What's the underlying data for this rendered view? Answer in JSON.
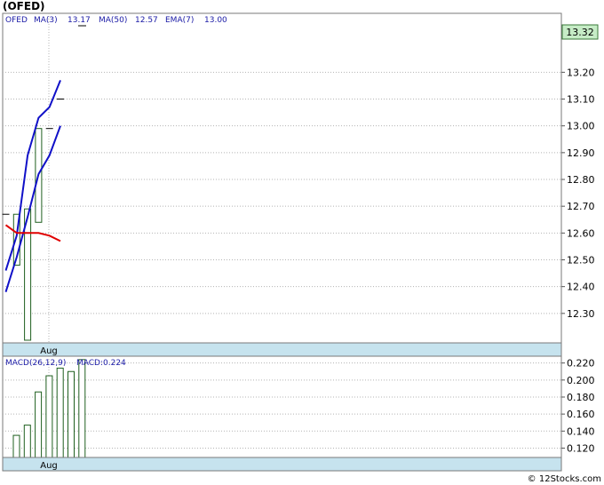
{
  "chart_data": [
    {
      "type": "candlestick",
      "title": "(OFED)",
      "legend": {
        "ticker": "OFED",
        "ma3_label": "MA(3)",
        "ma3_value": "13.17",
        "ma50_label": "MA(50)",
        "ma50_value": "12.57",
        "ema7_label": "EMA(7)",
        "ema7_value": "13.00"
      },
      "last_price": "13.32",
      "x_label": "Aug",
      "ylim": [
        12.19,
        13.42
      ],
      "yticks": [
        "12.30",
        "12.40",
        "12.50",
        "12.60",
        "12.70",
        "12.80",
        "12.90",
        "13.00",
        "13.10",
        "13.20"
      ],
      "grid": true,
      "candles": [
        {
          "open": 12.67,
          "high": 12.67,
          "low": 12.67,
          "close": 12.67
        },
        {
          "open": 12.48,
          "high": 12.67,
          "low": 12.48,
          "close": 12.67
        },
        {
          "open": 12.2,
          "high": 12.69,
          "low": 12.2,
          "close": 12.69
        },
        {
          "open": 12.64,
          "high": 12.99,
          "low": 12.64,
          "close": 12.99
        },
        {
          "open": 12.99,
          "high": 12.99,
          "low": 12.99,
          "close": 12.99
        },
        {
          "open": 13.1,
          "high": 13.1,
          "low": 13.1,
          "close": 13.1
        }
      ],
      "series": [
        {
          "name": "MA(3)",
          "color": "#1010c8",
          "values": [
            12.46,
            12.59,
            12.89,
            13.03,
            13.07,
            13.17
          ]
        },
        {
          "name": "EMA(7)",
          "color": "#1010c8",
          "values": [
            12.38,
            12.51,
            12.66,
            12.82,
            12.89,
            13.0
          ]
        },
        {
          "name": "MA(50)",
          "color": "#e00000",
          "values": [
            12.63,
            12.6,
            12.6,
            12.6,
            12.59,
            12.57
          ]
        }
      ]
    },
    {
      "type": "bar",
      "title": "MACD(26,12,9)",
      "value_label": "MACD:0.224",
      "x_label": "Aug",
      "ylim": [
        0.109,
        0.228
      ],
      "yticks": [
        "0.120",
        "0.140",
        "0.160",
        "0.180",
        "0.200",
        "0.220"
      ],
      "grid": true,
      "values": [
        0.135,
        0.147,
        0.186,
        0.205,
        0.214,
        0.21,
        0.224
      ]
    }
  ],
  "watermark": "© 12Stocks.com",
  "colors": {
    "bar_fill": "#ffffff",
    "bar_stroke": "#1f5f1f",
    "axis_band": "#c6e3ee",
    "grid": "#b4b4b4"
  }
}
